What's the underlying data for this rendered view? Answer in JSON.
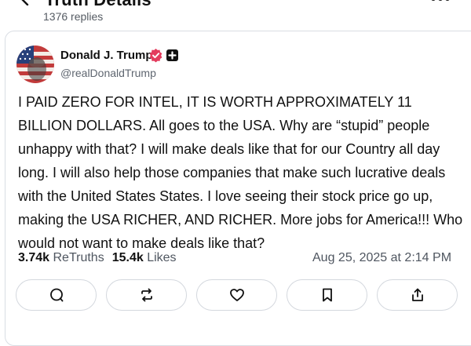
{
  "header": {
    "title": "Truth Details",
    "reply_count": "1376 replies"
  },
  "post": {
    "author": {
      "display_name": "Donald J. Trump",
      "handle": "@realDonaldTrump"
    },
    "body": "I PAID ZERO FOR INTEL, IT IS WORTH APPROXIMATELY 11 BILLION DOLLARS. All goes to the USA. Why are “stupid” people unhappy with that? I will make deals like that for our Country all day long. I will also help those companies that make such lucrative deals with the United States States. I love seeing their stock price go up, making the USA RICHER, AND RICHER. More jobs for America!!! Who would not want to make deals like that?",
    "stats": {
      "retruths_count": "3.74k",
      "retruths_label": "ReTruths",
      "likes_count": "15.4k",
      "likes_label": "Likes"
    },
    "timestamp": "Aug 25, 2025 at 2:14 PM"
  },
  "actions": [
    "comment-icon",
    "retruth-icon",
    "like-heart-icon",
    "bookmark-icon",
    "share-icon"
  ],
  "colors": {
    "verified_badge": "#e33b5d",
    "text_primary": "#111111",
    "text_secondary": "#5f6670",
    "border": "#d9dde3"
  }
}
